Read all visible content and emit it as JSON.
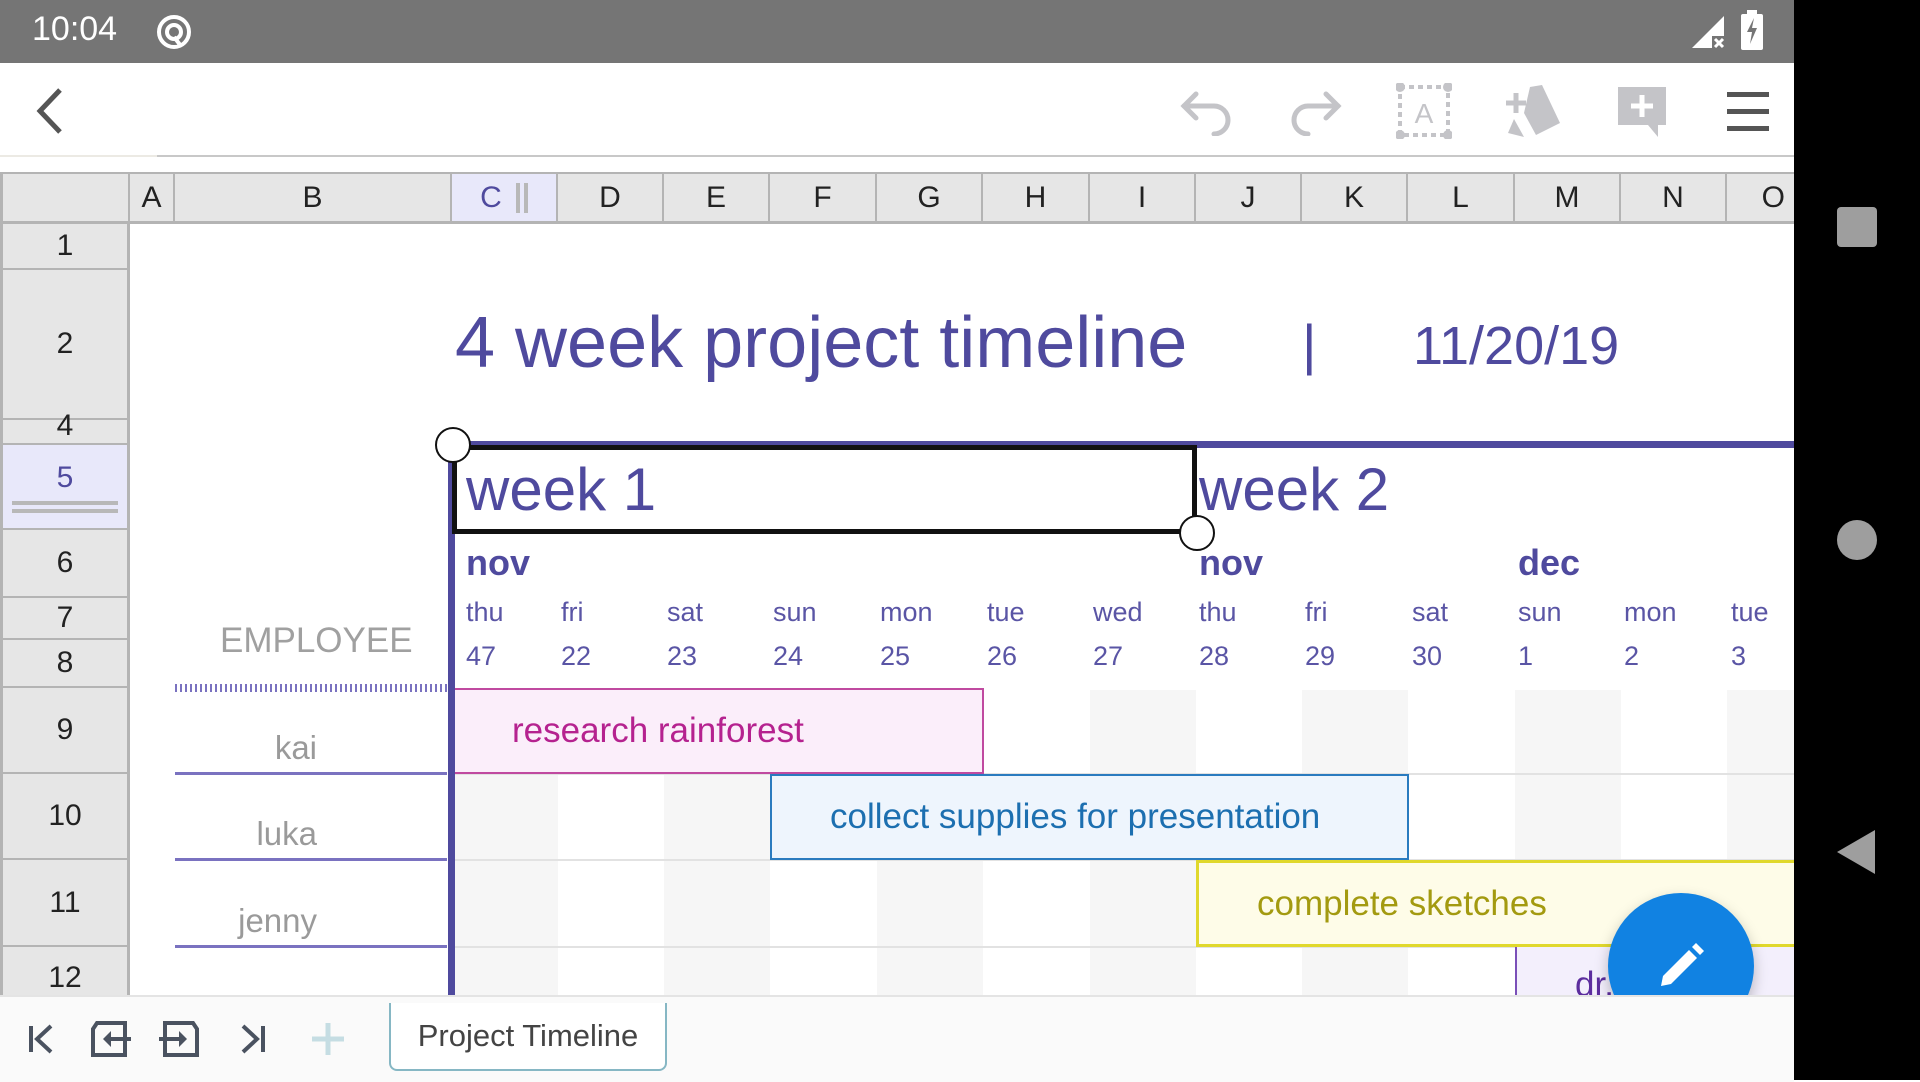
{
  "status_bar": {
    "time": "10:04",
    "icons": [
      "assistant-icon",
      "signal-no-sim-icon",
      "battery-charging-icon"
    ]
  },
  "toolbar": {
    "back": "back-icon",
    "actions": [
      {
        "name": "undo",
        "icon": "undo-icon"
      },
      {
        "name": "redo",
        "icon": "redo-icon"
      },
      {
        "name": "text-select",
        "icon": "text-select-icon"
      },
      {
        "name": "shapes",
        "icon": "shapes-icon"
      },
      {
        "name": "add-comment",
        "icon": "add-comment-icon"
      },
      {
        "name": "menu",
        "icon": "hamburger-menu-icon"
      }
    ]
  },
  "sheet": {
    "columns": [
      "A",
      "B",
      "C",
      "D",
      "E",
      "F",
      "G",
      "H",
      "I",
      "J",
      "K",
      "L",
      "M",
      "N",
      "O"
    ],
    "selected_column": "C",
    "rows": [
      "1",
      "2",
      "4",
      "5",
      "6",
      "7",
      "8",
      "9",
      "10",
      "11",
      "12"
    ],
    "selected_row": "5",
    "title": "4 week project timeline",
    "separator": "|",
    "date": "11/20/19",
    "weeks": [
      "week 1",
      "week 2"
    ],
    "months": [
      "nov",
      "nov",
      "dec"
    ],
    "employee_header": "EMPLOYEE",
    "days": [
      {
        "name": "thu",
        "num": "47"
      },
      {
        "name": "fri",
        "num": "22"
      },
      {
        "name": "sat",
        "num": "23"
      },
      {
        "name": "sun",
        "num": "24"
      },
      {
        "name": "mon",
        "num": "25"
      },
      {
        "name": "tue",
        "num": "26"
      },
      {
        "name": "wed",
        "num": "27"
      },
      {
        "name": "thu",
        "num": "28"
      },
      {
        "name": "fri",
        "num": "29"
      },
      {
        "name": "sat",
        "num": "30"
      },
      {
        "name": "sun",
        "num": "1"
      },
      {
        "name": "mon",
        "num": "2"
      },
      {
        "name": "tue",
        "num": "3"
      }
    ],
    "employees": [
      "kai",
      "luka",
      "jenny"
    ],
    "tasks": [
      {
        "label": "research rainforest",
        "employee": "kai",
        "color": "#b5228f",
        "bg": "#fbeefa"
      },
      {
        "label": "collect supplies for presentation",
        "employee": "luka",
        "color": "#1c6fb0",
        "bg": "#eef5fd"
      },
      {
        "label": "complete sketches",
        "employee": "jenny",
        "color": "#a39a10",
        "bg": "#fefce8"
      },
      {
        "label": "dr...nt",
        "employee": "",
        "color": "#5c2d9e",
        "bg": "#f3effc"
      }
    ]
  },
  "bottom_bar": {
    "nav_icons": [
      "first-sheet-icon",
      "move-sheet-left-icon",
      "move-sheet-right-icon",
      "last-sheet-icon",
      "add-sheet-icon"
    ],
    "sheet_tab": "Project Timeline"
  },
  "fab": {
    "icon": "edit-pencil-icon"
  },
  "colors": {
    "accent": "#4f4a9e",
    "fab": "#1182e2",
    "statusbar": "#757575"
  }
}
